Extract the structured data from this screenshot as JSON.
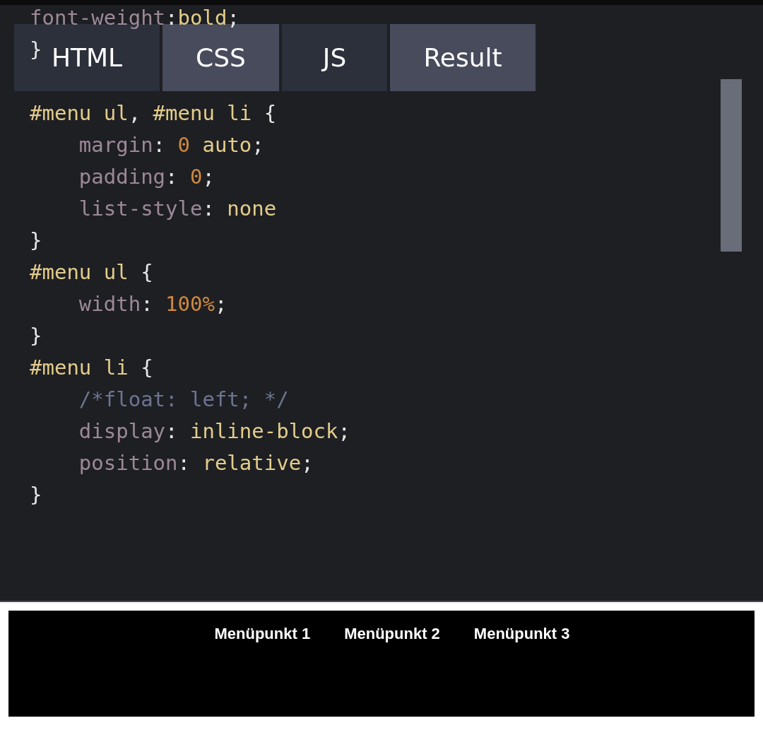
{
  "tabs": [
    {
      "label": "HTML",
      "selected": false
    },
    {
      "label": "CSS",
      "selected": true
    },
    {
      "label": "JS",
      "selected": false
    },
    {
      "label": "Result",
      "selected": true
    }
  ],
  "lines_behind_tabs": [
    {
      "tokens": [
        {
          "kind": "property",
          "text": "font-weight"
        },
        {
          "kind": "punct",
          "text": ":"
        },
        {
          "kind": "value",
          "text": "bold"
        },
        {
          "kind": "punct",
          "text": ";"
        }
      ]
    },
    {
      "tokens": [
        {
          "kind": "punct",
          "text": "}"
        }
      ]
    }
  ],
  "code_lines": [
    {
      "tokens": [
        {
          "kind": "selector",
          "text": "#menu ul"
        },
        {
          "kind": "punct",
          "text": ", "
        },
        {
          "kind": "selector",
          "text": "#menu li"
        },
        {
          "kind": "punct",
          "text": " {"
        }
      ]
    },
    {
      "tokens": [
        {
          "kind": "property",
          "text": "    margin"
        },
        {
          "kind": "punct",
          "text": ": "
        },
        {
          "kind": "number",
          "text": "0"
        },
        {
          "kind": "value",
          "text": " auto"
        },
        {
          "kind": "punct",
          "text": ";"
        }
      ]
    },
    {
      "tokens": [
        {
          "kind": "property",
          "text": "    padding"
        },
        {
          "kind": "punct",
          "text": ": "
        },
        {
          "kind": "number",
          "text": "0"
        },
        {
          "kind": "punct",
          "text": ";"
        }
      ]
    },
    {
      "tokens": [
        {
          "kind": "property",
          "text": "    list-style"
        },
        {
          "kind": "punct",
          "text": ": "
        },
        {
          "kind": "value",
          "text": "none"
        }
      ]
    },
    {
      "tokens": [
        {
          "kind": "punct",
          "text": "}"
        }
      ]
    },
    {
      "tokens": [
        {
          "kind": "selector",
          "text": "#menu ul"
        },
        {
          "kind": "punct",
          "text": " {"
        }
      ]
    },
    {
      "tokens": [
        {
          "kind": "property",
          "text": "    width"
        },
        {
          "kind": "punct",
          "text": ": "
        },
        {
          "kind": "number",
          "text": "100%"
        },
        {
          "kind": "punct",
          "text": ";"
        }
      ]
    },
    {
      "tokens": [
        {
          "kind": "punct",
          "text": "}"
        }
      ]
    },
    {
      "tokens": [
        {
          "kind": "selector",
          "text": "#menu li"
        },
        {
          "kind": "punct",
          "text": " {"
        }
      ]
    },
    {
      "tokens": [
        {
          "kind": "comment",
          "text": "    /*float: left; */"
        }
      ]
    },
    {
      "tokens": [
        {
          "kind": "property",
          "text": "    display"
        },
        {
          "kind": "punct",
          "text": ": "
        },
        {
          "kind": "value",
          "text": "inline-block"
        },
        {
          "kind": "punct",
          "text": ";"
        }
      ]
    },
    {
      "tokens": [
        {
          "kind": "property",
          "text": "    position"
        },
        {
          "kind": "punct",
          "text": ": "
        },
        {
          "kind": "value",
          "text": "relative"
        },
        {
          "kind": "punct",
          "text": ";"
        }
      ]
    },
    {
      "tokens": [
        {
          "kind": "punct",
          "text": "}"
        }
      ]
    }
  ],
  "result_menu": [
    "Menüpunkt 1",
    "Menüpunkt 2",
    "Menüpunkt 3"
  ]
}
